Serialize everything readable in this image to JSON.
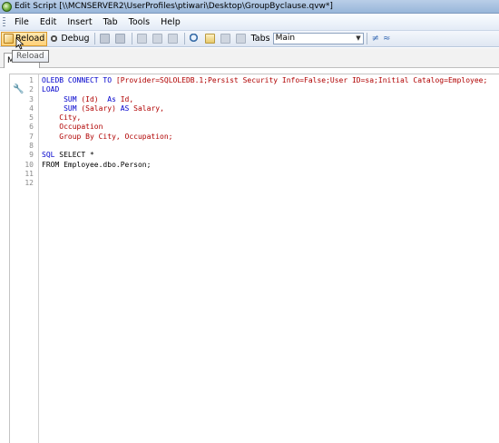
{
  "window": {
    "title": "Edit Script [\\\\MCNSERVER2\\UserProfiles\\ptiwari\\Desktop\\GroupByclause.qvw*]"
  },
  "menu": [
    "File",
    "Edit",
    "Insert",
    "Tab",
    "Tools",
    "Help"
  ],
  "toolbar": {
    "reload_label": "Reload",
    "debug_label": "Debug",
    "tabs_label": "Tabs",
    "tabs_value": "Main"
  },
  "tooltip": {
    "text": "Reload"
  },
  "tabstrip": {
    "active_tab": "M"
  },
  "editor": {
    "lines": [
      {
        "n": "1",
        "parts": [
          [
            "kw",
            "OLEDB CONNECT TO "
          ],
          [
            "red",
            "[Provider=SQLOLEDB.1;Persist Security Info=False;User ID=sa;Initial Catalog=Employee;"
          ]
        ]
      },
      {
        "n": "2",
        "parts": [
          [
            "kw",
            "LOAD"
          ]
        ]
      },
      {
        "n": "3",
        "parts": [
          [
            "blk",
            "     "
          ],
          [
            "kw",
            "SUM "
          ],
          [
            "red",
            "(Id)  "
          ],
          [
            "kw",
            "As "
          ],
          [
            "red",
            "Id,"
          ]
        ]
      },
      {
        "n": "4",
        "parts": [
          [
            "blk",
            "     "
          ],
          [
            "kw",
            "SUM "
          ],
          [
            "red",
            "(Salary) "
          ],
          [
            "kw",
            "AS "
          ],
          [
            "red",
            "Salary,"
          ]
        ]
      },
      {
        "n": "5",
        "parts": [
          [
            "blk",
            "    "
          ],
          [
            "red",
            "City,"
          ]
        ]
      },
      {
        "n": "6",
        "parts": [
          [
            "blk",
            "    "
          ],
          [
            "red",
            "Occupation"
          ]
        ]
      },
      {
        "n": "7",
        "parts": [
          [
            "blk",
            "    "
          ],
          [
            "red",
            "Group By City, Occupation;"
          ]
        ]
      },
      {
        "n": "8",
        "parts": []
      },
      {
        "n": "9",
        "parts": [
          [
            "kw",
            "SQL "
          ],
          [
            "blk",
            "SELECT *"
          ]
        ]
      },
      {
        "n": "10",
        "parts": [
          [
            "blk",
            "FROM Employee.dbo.Person;"
          ]
        ]
      },
      {
        "n": "11",
        "parts": []
      },
      {
        "n": "12",
        "parts": []
      }
    ]
  }
}
